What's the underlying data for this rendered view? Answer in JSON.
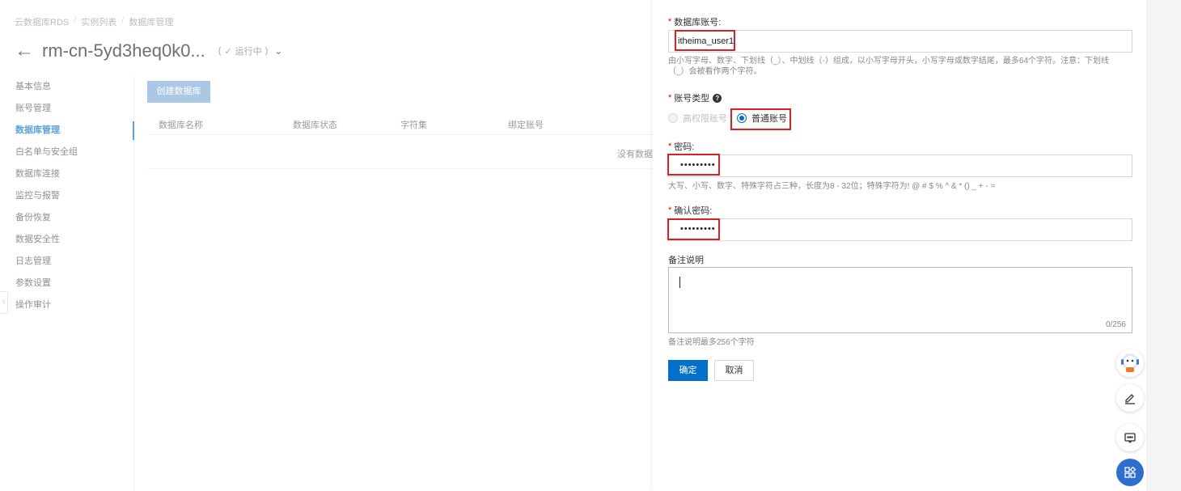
{
  "breadcrumb": [
    "云数据库RDS",
    "实例列表",
    "数据库管理"
  ],
  "instance": {
    "title": "rm-cn-5yd3heq0k0...",
    "status": "运行中"
  },
  "sidebar": {
    "items": [
      {
        "label": "基本信息"
      },
      {
        "label": "账号管理"
      },
      {
        "label": "数据库管理",
        "active": true
      },
      {
        "label": "白名单与安全组"
      },
      {
        "label": "数据库连接"
      },
      {
        "label": "监控与报警"
      },
      {
        "label": "备份恢复"
      },
      {
        "label": "数据安全性"
      },
      {
        "label": "日志管理"
      },
      {
        "label": "参数设置"
      },
      {
        "label": "操作审计"
      }
    ]
  },
  "db_table": {
    "create_button": "创建数据库",
    "columns": [
      "数据库名称",
      "数据库状态",
      "字符集",
      "绑定账号"
    ],
    "empty_text": "没有数据"
  },
  "form": {
    "account_label": "数据库账号:",
    "account_value": "itheima_user1",
    "account_hint": "由小写字母、数字、下划线（_）、中划线（-）组成，以小写字母开头，小写字母或数字结尾，最多64个字符。注意：下划线（_）会被看作两个字符。",
    "type_label": "账号类型",
    "type_options": [
      {
        "label": "高权限账号",
        "disabled": true
      },
      {
        "label": "普通账号",
        "checked": true
      }
    ],
    "password_label": "密码:",
    "password_value": "•••••••••",
    "password_hint": "大写、小写、数字、特殊字符占三种，长度为8 - 32位；特殊字符为! @ # $ % ^ & * () _ + - =",
    "confirm_label": "确认密码:",
    "confirm_value": "•••••••••",
    "remark_label": "备注说明",
    "remark_counter": "0/256",
    "remark_hint": "备注说明最多256个字符",
    "ok_label": "确定",
    "cancel_label": "取消"
  },
  "float_tools": [
    "assistant-avatar-icon",
    "edit-icon",
    "feedback-icon",
    "apps-icon"
  ],
  "colors": {
    "primary": "#0070cc",
    "highlight": "#e02020",
    "fab": "#2d6fd1"
  }
}
